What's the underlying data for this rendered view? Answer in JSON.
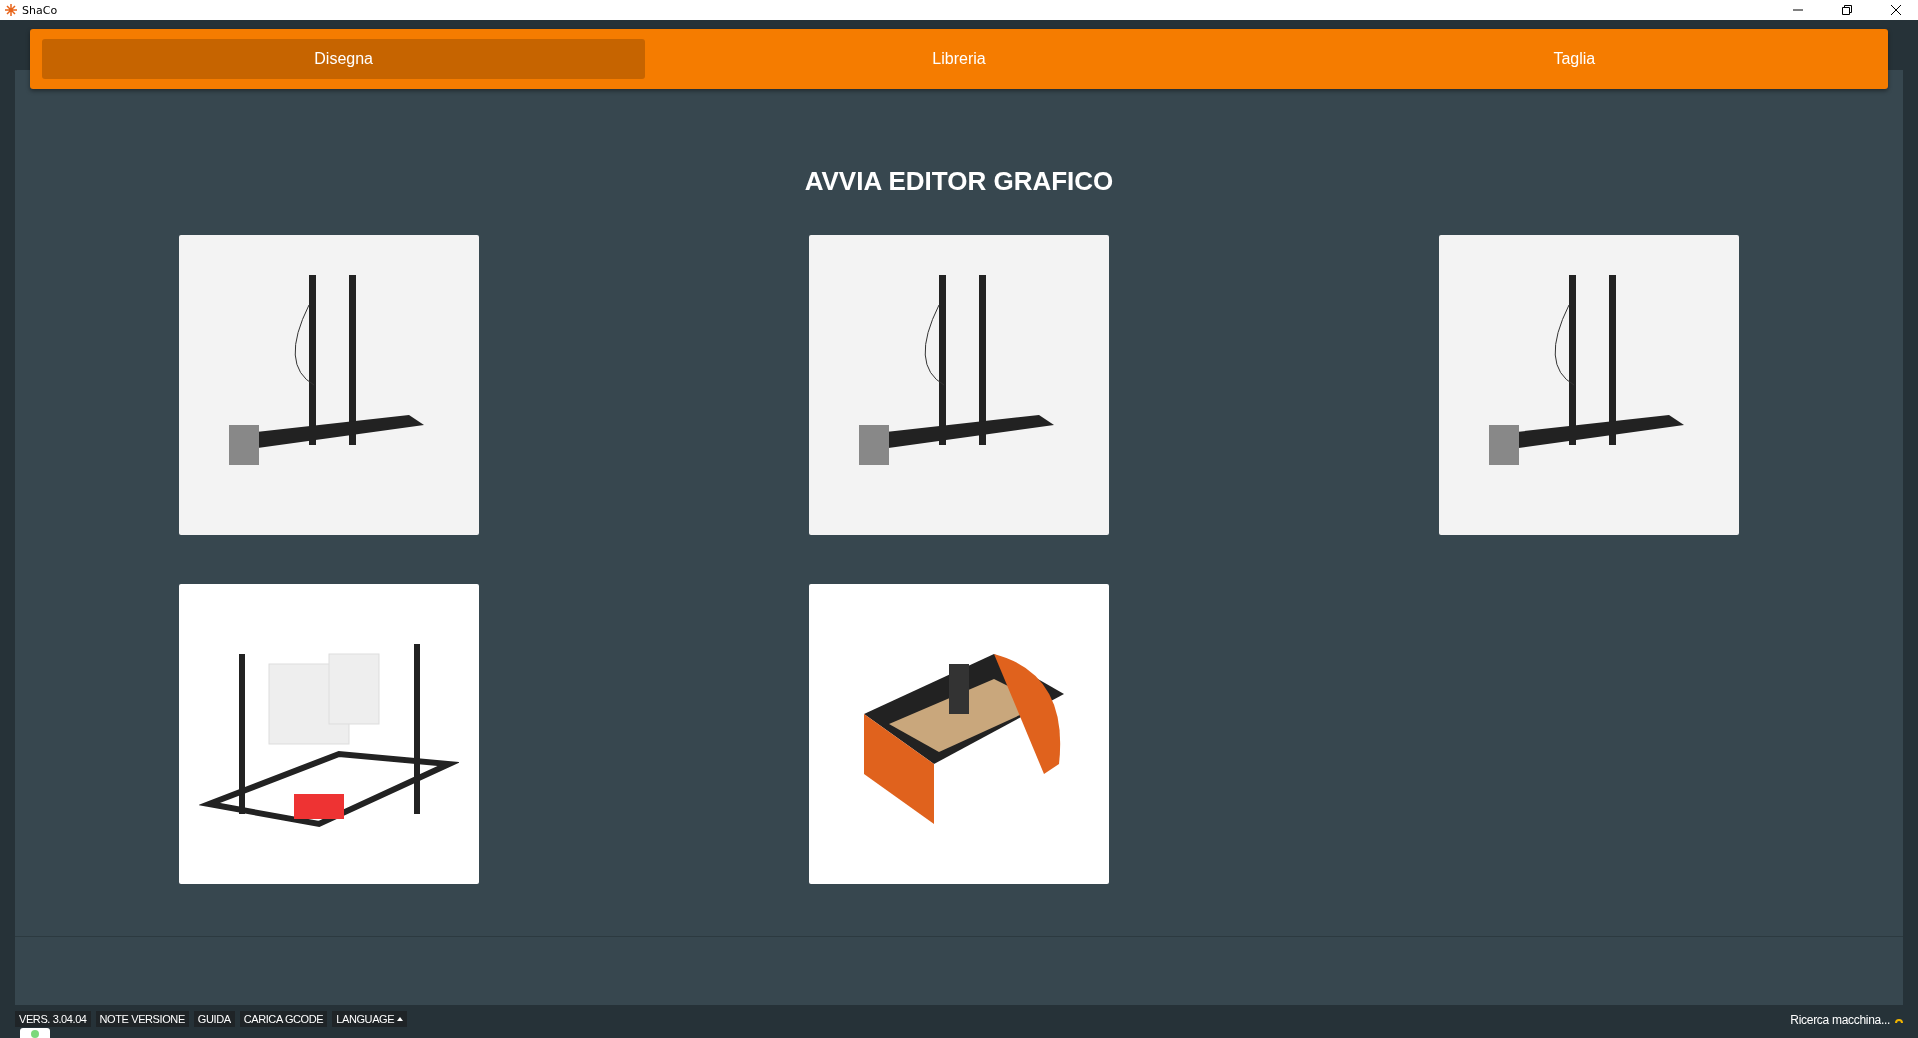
{
  "window": {
    "title": "ShaCo"
  },
  "tabs": [
    {
      "label": "Disegna",
      "selected": true
    },
    {
      "label": "Libreria",
      "selected": false
    },
    {
      "label": "Taglia",
      "selected": false
    }
  ],
  "heading": "AVVIA EDITOR GRAFICO",
  "machines": [
    {
      "kind": "vertical"
    },
    {
      "kind": "vertical"
    },
    {
      "kind": "vertical"
    },
    {
      "kind": "table"
    },
    {
      "kind": "router"
    }
  ],
  "footer": {
    "buttons": [
      "VERS. 3.04.04",
      "NOTE VERSIONE",
      "GUIDA",
      "CARICA GCODE",
      "LANGUAGE"
    ],
    "status": "Ricerca macchina..."
  }
}
